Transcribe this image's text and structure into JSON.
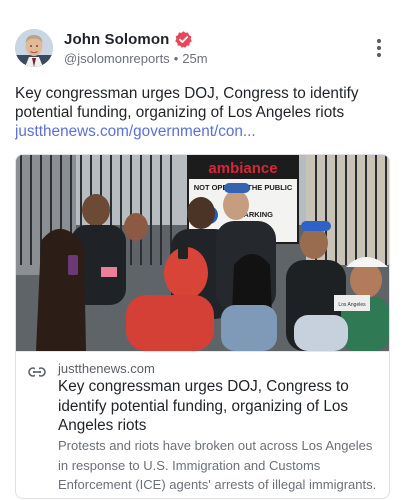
{
  "author": {
    "name": "John Solomon",
    "handle": "@jsolomonreports",
    "separator": "•",
    "time": "25m",
    "verified_badge": "verified-icon",
    "avatar": "avatar"
  },
  "post": {
    "text": "Key congressman urges DOJ, Congress to identify potential funding, organizing of Los Angeles riots",
    "link_text": "justthenews.com/government/con..."
  },
  "card": {
    "image_sign_title": "ambiance",
    "image_sign_line1": "NOT OPEN TO THE PUBLIC",
    "image_sign_line2": "PARKING",
    "image_cap_text": "Los Angeles",
    "domain": "justthenews.com",
    "title": "Key congressman urges DOJ, Congress to identify potential funding, organizing of Los Angeles riots",
    "description": "Protests and riots have broken out across Los Angeles in response to U.S. Immigration and Customs Enforcement (ICE) agents' arrests of illegal immigrants."
  },
  "icons": {
    "more": "more-vertical-icon",
    "link": "link-icon"
  },
  "colors": {
    "accent": "#5a6fd8",
    "verified": "#e8465a",
    "text": "#1f2328",
    "muted": "#6b7078"
  }
}
